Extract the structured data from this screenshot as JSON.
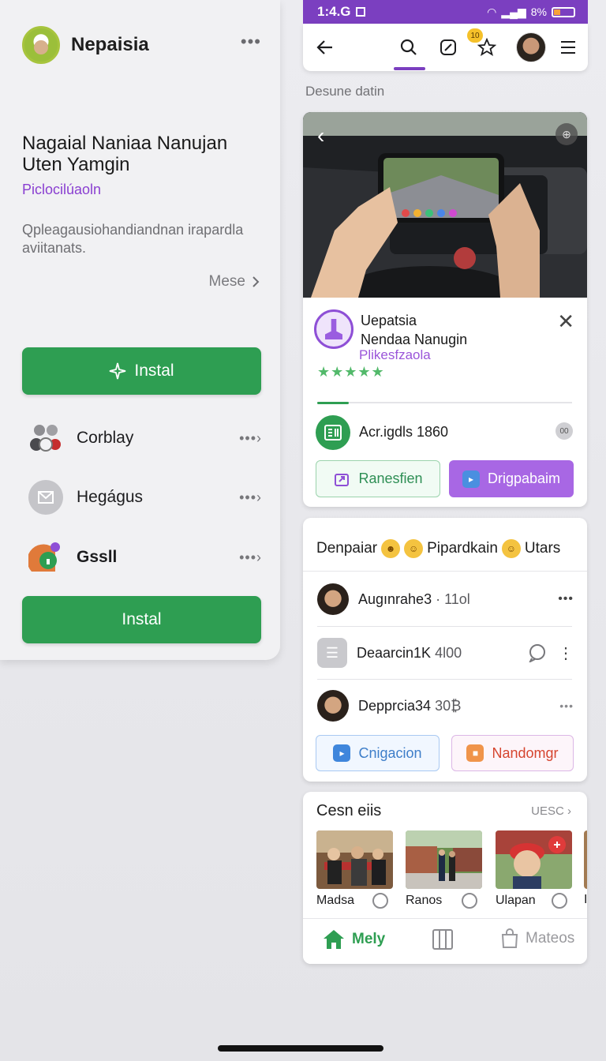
{
  "left_panel": {
    "title": "Nepaisia",
    "headline": "Nagaial Naniaa Nanujan Uten Yamgin",
    "subtitle": "Piclocilúaoln",
    "description": "Qpleagausiohandiandnan irapardla aviitanats.",
    "more_label": "Mese",
    "install_top_label": "Instal",
    "install_bottom_label": "Instal",
    "apps": [
      {
        "name": "Corblay",
        "icon": "people-icon"
      },
      {
        "name": "Hegágus",
        "icon": "mail-icon"
      },
      {
        "name": "Gssll",
        "icon": "game-icon"
      }
    ]
  },
  "status_bar": {
    "time": "1:4.G",
    "battery": "8%"
  },
  "toolbar": {
    "badge": "10"
  },
  "section_label": "Desune datin",
  "featured": {
    "name": "Uepatsia",
    "name_line2": "Nendaa Nanugin",
    "publisher": "Plikesfzaola",
    "rating": "★★★★★",
    "app_label": "Acr.igdls 1860",
    "app_badge": "00",
    "button_outline": "Ranesfien",
    "button_solid": "Drigpabaim"
  },
  "feed": {
    "header_part1": "Denpaiar",
    "header_part2": "Pipardkain",
    "header_part3": "Utars",
    "rows": [
      {
        "name": "Augınrahe3",
        "meta": "· 11ol"
      },
      {
        "name": "Deaarcin1K",
        "meta": "4l00"
      },
      {
        "name": "Depprcia34",
        "meta": "30₿"
      }
    ],
    "button_left": "Cnigacion",
    "button_right": "Nandomgr"
  },
  "gallery": {
    "title": "Cesn eiis",
    "more_label": "UESC",
    "tiles": [
      "Madsa",
      "Ranos",
      "Ulapan",
      "I"
    ]
  },
  "bottom_nav": {
    "home_label": "Mely",
    "third_label": "Mateos"
  }
}
